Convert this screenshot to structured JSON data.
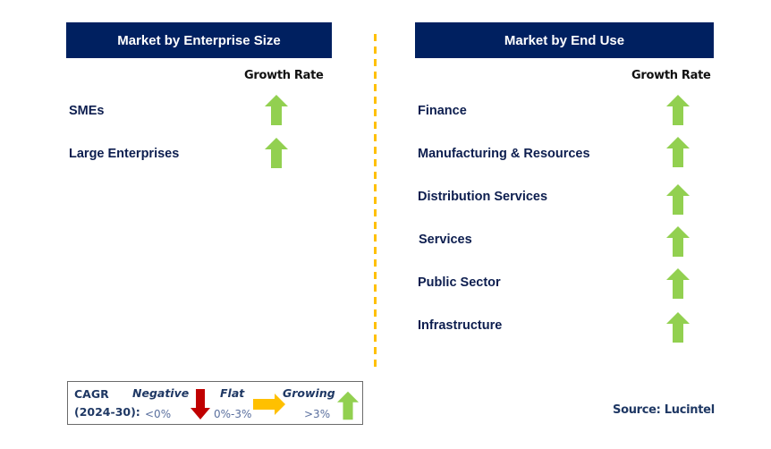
{
  "left_panel": {
    "title": "Market by Enterprise Size",
    "column_header": "Growth Rate",
    "rows": [
      {
        "label": "SMEs",
        "trend": "growing"
      },
      {
        "label": "Large Enterprises",
        "trend": "growing"
      }
    ]
  },
  "right_panel": {
    "title": "Market by End Use",
    "column_header": "Growth Rate",
    "rows": [
      {
        "label": "Finance",
        "trend": "growing"
      },
      {
        "label": "Manufacturing & Resources",
        "trend": "growing"
      },
      {
        "label": "Distribution Services",
        "trend": "growing"
      },
      {
        "label": "Services",
        "trend": "growing"
      },
      {
        "label": "Public Sector",
        "trend": "growing"
      },
      {
        "label": "Infrastructure",
        "trend": "growing"
      }
    ]
  },
  "legend": {
    "cagr_label": "CAGR",
    "period_label": "(2024-30):",
    "negative_label": "Negative",
    "negative_range": "<0%",
    "flat_label": "Flat",
    "flat_range": "0%-3%",
    "growing_label": "Growing",
    "growing_range": ">3%"
  },
  "source": "Source: Lucintel",
  "colors": {
    "header_bg": "#002060",
    "growing": "#92d050",
    "flat": "#ffc000",
    "negative": "#c00000",
    "divider": "#ffc000",
    "label_text": "#0d1e4f"
  }
}
